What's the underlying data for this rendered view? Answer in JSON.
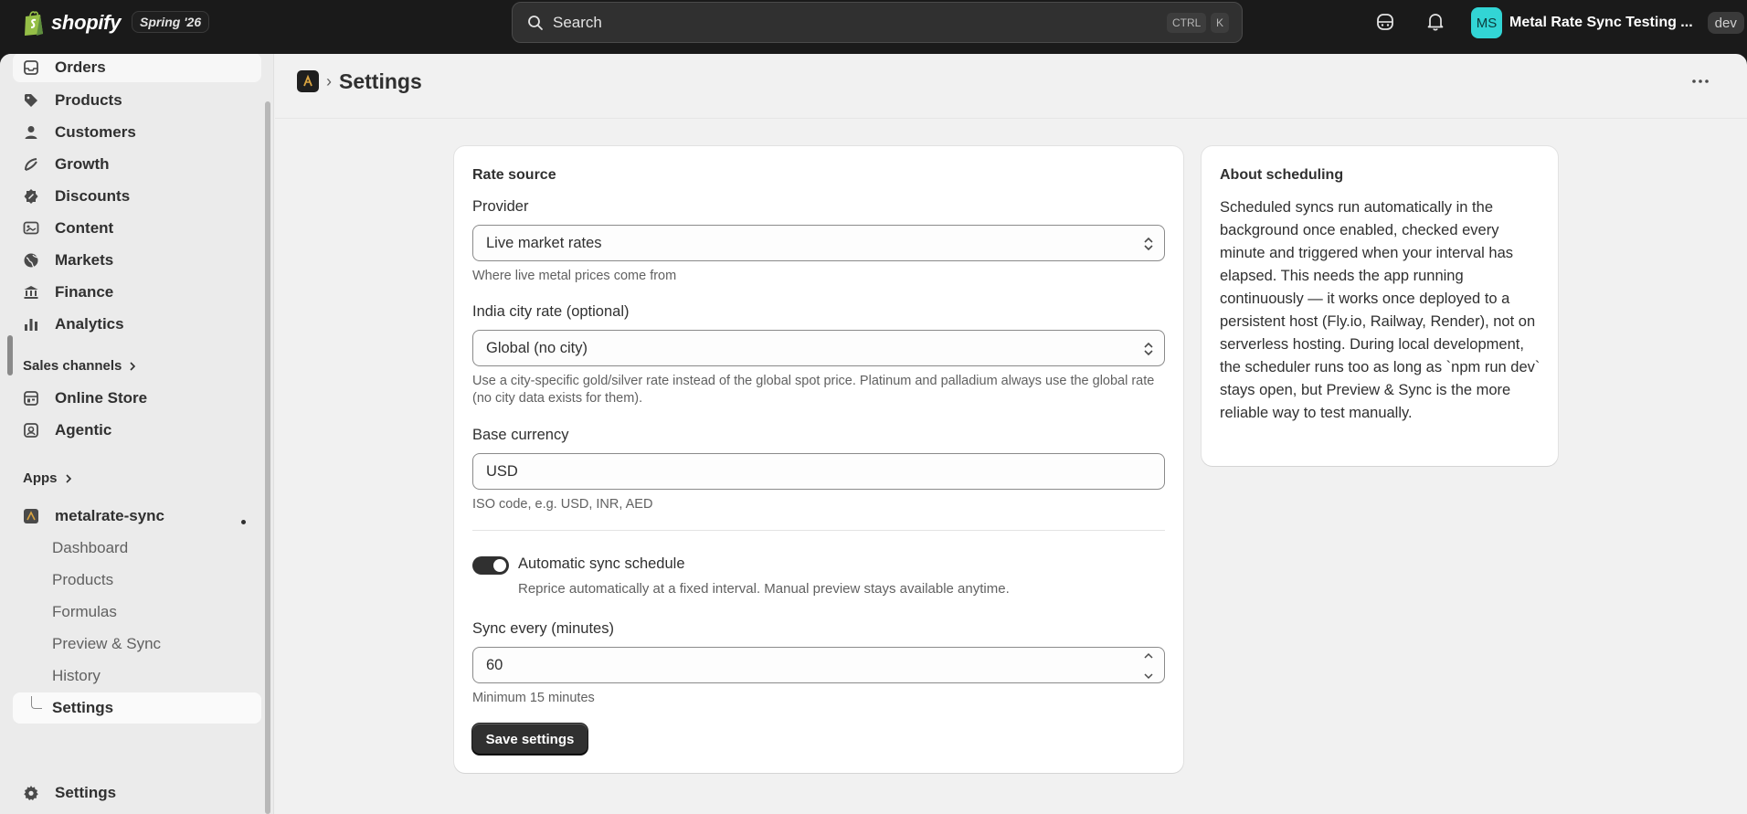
{
  "topbar": {
    "brand": "shopify",
    "release_badge": "Spring '26",
    "search_placeholder": "Search",
    "shortcut_ctrl": "CTRL",
    "shortcut_k": "K",
    "store_initials": "MS",
    "store_name": "Metal Rate Sync Testing ...",
    "env_badge": "dev",
    "colors": {
      "bar": "#1a1a1a",
      "avatar": "#32d5d5"
    }
  },
  "sidebar": {
    "items": [
      {
        "label": "Orders",
        "icon": "inbox-icon"
      },
      {
        "label": "Products",
        "icon": "tag-icon"
      },
      {
        "label": "Customers",
        "icon": "person-icon"
      },
      {
        "label": "Growth",
        "icon": "growth-icon"
      },
      {
        "label": "Discounts",
        "icon": "discount-icon"
      },
      {
        "label": "Content",
        "icon": "content-icon"
      },
      {
        "label": "Markets",
        "icon": "globe-icon"
      },
      {
        "label": "Finance",
        "icon": "bank-icon"
      },
      {
        "label": "Analytics",
        "icon": "bar-chart-icon"
      }
    ],
    "sales_channels_heading": "Sales channels",
    "channels": [
      {
        "label": "Online Store",
        "icon": "store-icon"
      },
      {
        "label": "Agentic",
        "icon": "agentic-icon"
      }
    ],
    "apps_heading": "Apps",
    "app": {
      "name": "metalrate-sync",
      "subitems": [
        "Dashboard",
        "Products",
        "Formulas",
        "Preview & Sync",
        "History",
        "Settings"
      ]
    },
    "footer_settings": "Settings"
  },
  "page": {
    "title": "Settings"
  },
  "form": {
    "section_title": "Rate source",
    "provider": {
      "label": "Provider",
      "value": "Live market rates",
      "help": "Where live metal prices come from"
    },
    "city": {
      "label": "India city rate (optional)",
      "value": "Global (no city)",
      "help": "Use a city-specific gold/silver rate instead of the global spot price. Platinum and palladium always use the global rate (no city data exists for them)."
    },
    "currency": {
      "label": "Base currency",
      "value": "USD",
      "help": "ISO code, e.g. USD, INR, AED"
    },
    "schedule": {
      "label": "Automatic sync schedule",
      "help": "Reprice automatically at a fixed interval. Manual preview stays available anytime.",
      "enabled": true
    },
    "interval": {
      "label": "Sync every (minutes)",
      "value": "60",
      "help": "Minimum 15 minutes"
    },
    "save_label": "Save settings"
  },
  "about": {
    "title": "About scheduling",
    "body": "Scheduled syncs run automatically in the background once enabled, checked every minute and triggered when your interval has elapsed. This needs the app running continuously — it works once deployed to a persistent host (Fly.io, Railway, Render), not on serverless hosting. During local development, the scheduler runs too as long as `npm run dev` stays open, but Preview & Sync is the more reliable way to test manually."
  }
}
